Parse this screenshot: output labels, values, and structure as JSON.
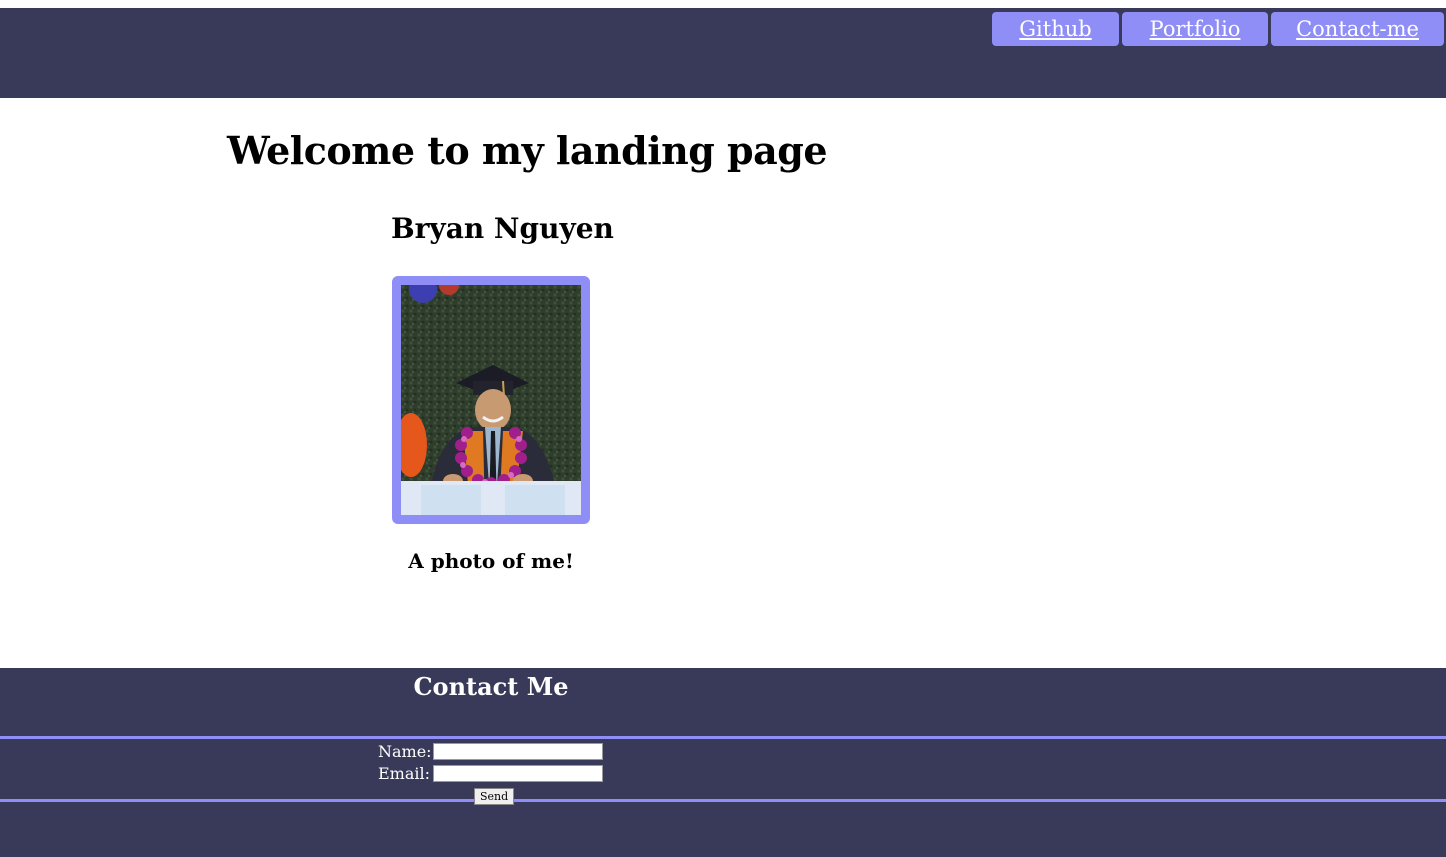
{
  "nav": {
    "links": [
      {
        "label": "Github"
      },
      {
        "label": "Portfolio"
      },
      {
        "label": "Contact-me"
      }
    ]
  },
  "main": {
    "heading": "Welcome to my landing page",
    "name": "Bryan Nguyen",
    "caption": "A photo of me!"
  },
  "contact": {
    "title": "Contact Me",
    "name_label": "Name:",
    "email_label": "Email:",
    "name_value": "",
    "email_value": "",
    "send_label": "Send"
  },
  "colors": {
    "header_bg": "#393959",
    "accent": "#8f8ef6",
    "text_light": "#ffffff"
  }
}
